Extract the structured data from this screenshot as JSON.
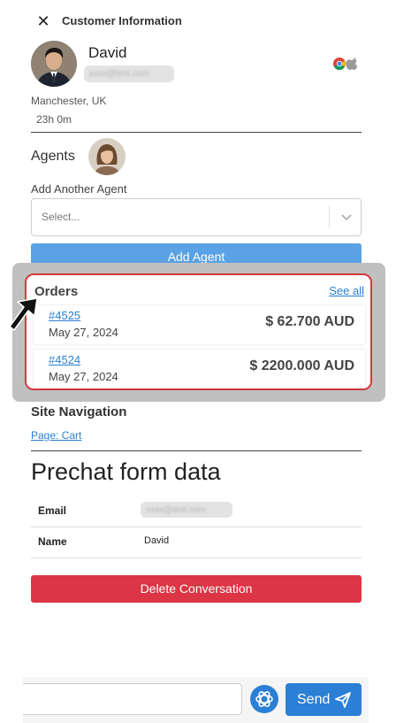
{
  "header": {
    "title": "Customer Information",
    "close_icon": "close-icon"
  },
  "customer": {
    "name": "David",
    "email_masked": "xxxx@test.com",
    "location": "Manchester, UK",
    "duration": "23h 0m",
    "browser_icons": [
      "chrome-icon",
      "apple-icon"
    ]
  },
  "agents": {
    "label": "Agents",
    "add_label": "Add Another Agent",
    "select_placeholder": "Select...",
    "add_button": "Add Agent"
  },
  "orders": {
    "title": "Orders",
    "see_all": "See all",
    "items": [
      {
        "id": "#4525",
        "date": "May 27, 2024",
        "amount": "$ 62.700 AUD"
      },
      {
        "id": "#4524",
        "date": "May 27, 2024",
        "amount": "$ 2200.000 AUD"
      }
    ]
  },
  "site_navigation": {
    "label": "Site Navigation",
    "link": "Page: Cart"
  },
  "prechat": {
    "title": "Prechat form data",
    "rows": [
      {
        "key": "Email",
        "value_masked": "xxxx@test.com"
      },
      {
        "key": "Name",
        "value": "David"
      }
    ]
  },
  "delete_button": "Delete Conversation",
  "composer": {
    "message_placeholder": "",
    "send_label": "Send",
    "ai_icon": "openai-icon",
    "send_icon": "paper-plane-icon"
  },
  "colors": {
    "accent": "#2b7fd4",
    "danger": "#dc3545",
    "highlight_border": "#d33b3b",
    "add_agent": "#5aa2e3"
  }
}
